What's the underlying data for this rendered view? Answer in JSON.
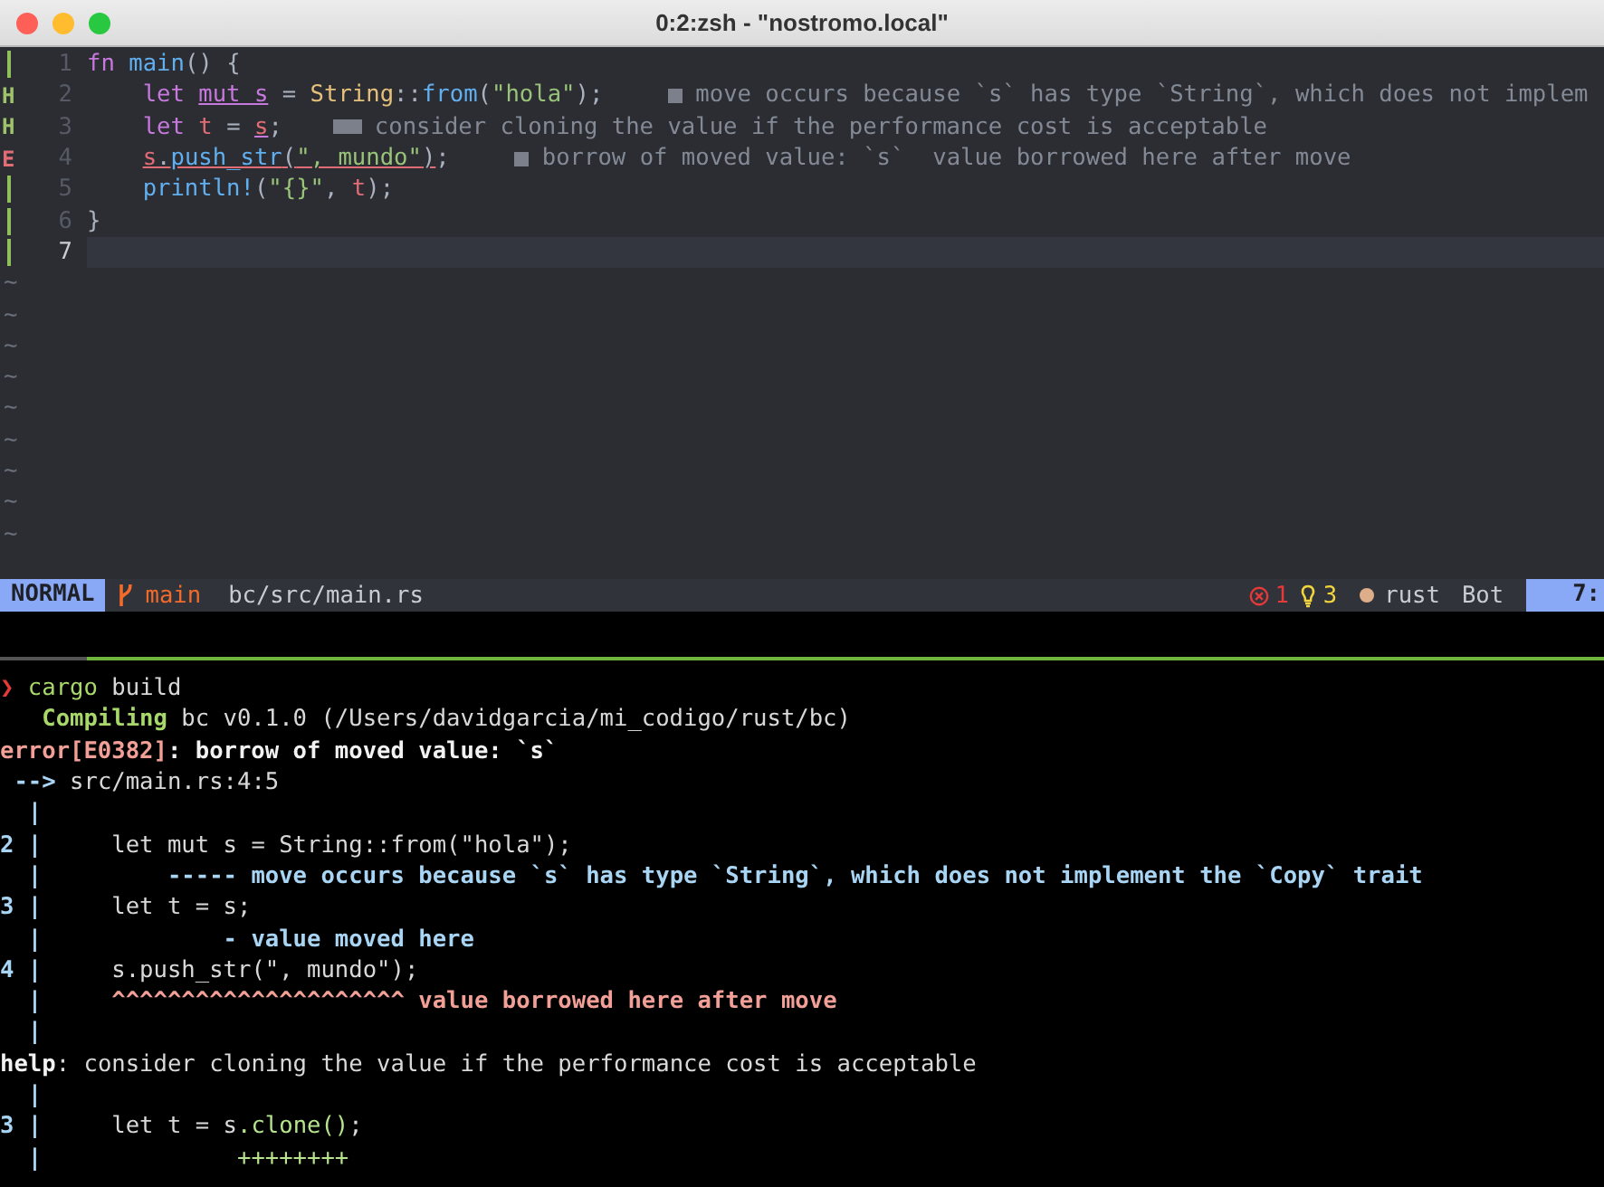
{
  "window": {
    "title": "0:2:zsh - \"nostromo.local\""
  },
  "editor": {
    "lines": [
      {
        "number": "1",
        "current": false,
        "indented": false,
        "sign": {
          "kind": "added"
        },
        "tokens": [
          {
            "text": "fn",
            "kind": "keyword"
          },
          {
            "text": " main",
            "kind": "function"
          },
          {
            "text": "() {",
            "kind": "punct"
          }
        ]
      },
      {
        "number": "2",
        "current": false,
        "indented": true,
        "sign": {
          "kind": "hint",
          "text": "H"
        },
        "tokens": [
          {
            "text": "let ",
            "kind": "keyword"
          },
          {
            "text": "mut s",
            "kind": "keyword",
            "underlined": true
          },
          {
            "text": " = ",
            "kind": "punct"
          },
          {
            "text": "String",
            "kind": "type"
          },
          {
            "text": "::",
            "kind": "punct"
          },
          {
            "text": "from",
            "kind": "function"
          },
          {
            "text": "(",
            "kind": "punct"
          },
          {
            "text": "\"hola\"",
            "kind": "string"
          },
          {
            "text": ");",
            "kind": "punct"
          }
        ],
        "diagnostic": {
          "kind": "info",
          "text": "move occurs because `s` has type `String`, which does not implem"
        }
      },
      {
        "number": "3",
        "current": false,
        "indented": true,
        "sign": {
          "kind": "hint",
          "text": "H"
        },
        "tokens": [
          {
            "text": "let",
            "kind": "keyword"
          },
          {
            "text": " t",
            "kind": "variable"
          },
          {
            "text": " = ",
            "kind": "punct"
          },
          {
            "text": "s",
            "kind": "variable",
            "underlined": true
          },
          {
            "text": ";",
            "kind": "punct"
          }
        ],
        "diagnostic": {
          "kind": "hint",
          "text": "consider cloning the value if the performance cost is acceptable"
        }
      },
      {
        "number": "4",
        "current": false,
        "indented": true,
        "sign": {
          "kind": "error",
          "text": "E"
        },
        "tokens": [
          {
            "text": "s",
            "kind": "variable",
            "underlined": true
          },
          {
            "text": ".",
            "kind": "punct",
            "underlined": true
          },
          {
            "text": "push_str",
            "kind": "function",
            "underlined": true
          },
          {
            "text": "(",
            "kind": "punct",
            "underlined": true
          },
          {
            "text": "\", mundo\"",
            "kind": "string",
            "underlined": true
          },
          {
            "text": ")",
            "kind": "punct",
            "underlined": true
          },
          {
            "text": ";",
            "kind": "punct"
          }
        ],
        "diagnostic": {
          "kind": "info",
          "text": "borrow of moved value: `s`  value borrowed here after move"
        }
      },
      {
        "number": "5",
        "current": false,
        "indented": true,
        "sign": {
          "kind": "added"
        },
        "tokens": [
          {
            "text": "println!",
            "kind": "function"
          },
          {
            "text": "(",
            "kind": "punct"
          },
          {
            "text": "\"{}\"",
            "kind": "string"
          },
          {
            "text": ", ",
            "kind": "punct"
          },
          {
            "text": "t",
            "kind": "variable"
          },
          {
            "text": ");",
            "kind": "punct"
          }
        ]
      },
      {
        "number": "6",
        "current": false,
        "indented": false,
        "sign": {
          "kind": "added"
        },
        "tokens": [
          {
            "text": "}",
            "kind": "punct"
          }
        ]
      },
      {
        "number": "7",
        "current": true,
        "sign": {
          "kind": "added"
        }
      }
    ],
    "filler_lines": [
      "~",
      "~",
      "~",
      "~",
      "~",
      "~",
      "~",
      "~",
      "~"
    ]
  },
  "status_line": {
    "mode": "NORMAL",
    "branch": "main",
    "file": "bc/src/main.rs",
    "errors": "1",
    "hints": "3",
    "filetype": "rust",
    "scroll": "Bot",
    "cursor": "7:"
  },
  "terminal": {
    "lines": [
      [
        {
          "text": "❯",
          "kind": "prompt"
        },
        {
          "text": " cargo",
          "kind": "command"
        },
        {
          "text": " build",
          "kind": "plain"
        }
      ],
      [
        {
          "text": "   Compiling",
          "kind": "compiling"
        },
        {
          "text": " bc v0.1.0 (/Users/davidgarcia/mi_codigo/rust/bc)",
          "kind": "plain"
        }
      ],
      [
        {
          "text": "error[E0382]",
          "kind": "error"
        },
        {
          "text": ": borrow of moved value: `s`",
          "kind": "bold"
        }
      ],
      [
        {
          "text": " --> ",
          "kind": "gutter"
        },
        {
          "text": "src/main.rs:4:5",
          "kind": "plain"
        }
      ],
      [
        {
          "text": "  |",
          "kind": "gutter"
        }
      ],
      [
        {
          "text": "2 |",
          "kind": "gutter"
        },
        {
          "text": "     let mut s = String::from(\"hola\");",
          "kind": "plain"
        }
      ],
      [
        {
          "text": "  |",
          "kind": "gutter"
        },
        {
          "text": "         ----- move occurs because `s` has type `String`, which does not implement the `Copy` trait",
          "kind": "note"
        }
      ],
      [
        {
          "text": "3 |",
          "kind": "gutter"
        },
        {
          "text": "     let t = s;",
          "kind": "plain"
        }
      ],
      [
        {
          "text": "  |",
          "kind": "gutter"
        },
        {
          "text": "             - value moved here",
          "kind": "note"
        }
      ],
      [
        {
          "text": "4 |",
          "kind": "gutter"
        },
        {
          "text": "     s.push_str(\", mundo\");",
          "kind": "plain"
        }
      ],
      [
        {
          "text": "  |",
          "kind": "gutter"
        },
        {
          "text": "     ^^^^^^^^^^^^^^^^^^^^^ value borrowed here after move",
          "kind": "primary"
        }
      ],
      [
        {
          "text": "  |",
          "kind": "gutter"
        }
      ],
      [
        {
          "text": "help",
          "kind": "bold"
        },
        {
          "text": ": consider cloning the value if the performance cost is acceptable",
          "kind": "plain"
        }
      ],
      [
        {
          "text": "  |",
          "kind": "gutter"
        }
      ],
      [
        {
          "text": "3 |",
          "kind": "gutter"
        },
        {
          "text": "     let t = s",
          "kind": "plain"
        },
        {
          "text": ".clone()",
          "kind": "added"
        },
        {
          "text": ";",
          "kind": "plain"
        }
      ],
      [
        {
          "text": "  |",
          "kind": "gutter"
        },
        {
          "text": "              ++++++++",
          "kind": "added"
        }
      ]
    ]
  }
}
